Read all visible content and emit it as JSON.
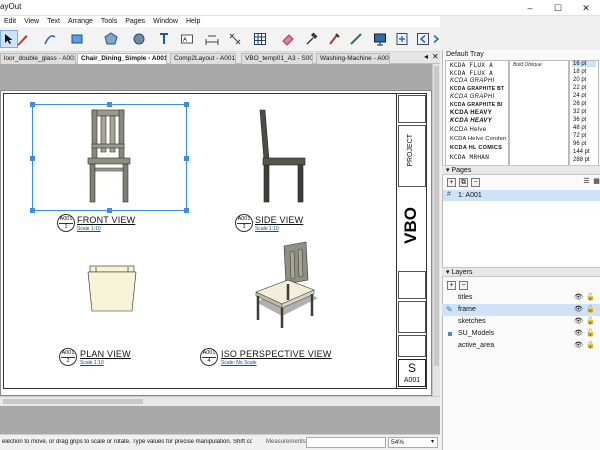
{
  "app": {
    "title": "ayOut"
  },
  "window_controls": {
    "minimize": "–",
    "maximize": "☐",
    "close": "✕"
  },
  "menu": [
    "Edit",
    "View",
    "Text",
    "Arrange",
    "Tools",
    "Pages",
    "Window",
    "Help"
  ],
  "toolbar_icons": [
    "select-arrow-icon",
    "pencil-line-icon",
    "arc-icon",
    "rectangle-icon",
    "polygon-icon",
    "circle-icon",
    "text-icon",
    "label-icon",
    "dimension-icon",
    "table-icon",
    "eraser-icon",
    "style-sampler-icon",
    "split-icon",
    "join-icon",
    "presentation-icon",
    "add-page-icon",
    "previous-page-icon",
    "next-page-icon"
  ],
  "tabs": [
    {
      "label": "loor_double_glass - A001",
      "active": false
    },
    {
      "label": "Chair_Dining_Simple - A001",
      "active": true
    },
    {
      "label": "Comp2Layout - A001",
      "active": false
    },
    {
      "label": "VBO_temp01_A3 - S001",
      "active": false
    },
    {
      "label": "Washing-Machine - A001",
      "active": false
    }
  ],
  "drawing": {
    "views": [
      {
        "name": "FRONT VIEW",
        "sheet": "A001",
        "num": "1",
        "scale": "Scale 1:10"
      },
      {
        "name": "SIDE VIEW",
        "sheet": "A001",
        "num": "3",
        "scale": "Scale 1:10"
      },
      {
        "name": "PLAN VIEW",
        "sheet": "A001",
        "num": "2",
        "scale": "Scale 1:10"
      },
      {
        "name": "ISO PERSPECTIVE VIEW",
        "sheet": "A001",
        "num": "4",
        "scale": "Scale: No Scale"
      }
    ],
    "titleblock": {
      "project": "PROJECT",
      "logo": "VBO",
      "sheet_letter": "S",
      "sheet_id": "A001"
    }
  },
  "status": {
    "hint": "election to move, or drag grips to scale or rotate. Type values for precise manipulation. Shift constr...",
    "measurements_label": "Measurements",
    "zoom": "54%"
  },
  "tray": {
    "title": "Default Tray",
    "fonts": [
      "KCDA FLUX A",
      "KCDA FLUX A",
      "KCDA GRAPHI",
      "KCDA GRAPHITE BT",
      "KCDA GRAPHI",
      "KCDA GRAPHITE BI",
      "KCDA HEAVY",
      "KCDA HEAVY",
      "KCDA Helve",
      "KCDA Helve Conden",
      "KCDA HL COMICS",
      "KCDA MRHAN"
    ],
    "font_preview": "Bold Oblique",
    "sizes": [
      "16 pt",
      "18 pt",
      "20 pt",
      "22 pt",
      "24 pt",
      "26 pt",
      "32 pt",
      "36 pt",
      "48 pt",
      "72 pt",
      "96 pt",
      "144 pt",
      "288 pt"
    ],
    "selected_size": "16 pt",
    "pages_title": "Pages",
    "page_entry": "1: A001",
    "layers_title": "Layers",
    "layers": [
      {
        "name": "titles",
        "selected": false
      },
      {
        "name": "frame",
        "selected": true
      },
      {
        "name": "sketches",
        "selected": false
      },
      {
        "name": "SU_Models",
        "selected": false
      },
      {
        "name": "active_area",
        "selected": false
      }
    ]
  },
  "colors": {
    "accent": "#3a8ee6",
    "selection": "#cfe3f8",
    "paper": "#ffffff",
    "canvas": "#a9a9a9"
  }
}
